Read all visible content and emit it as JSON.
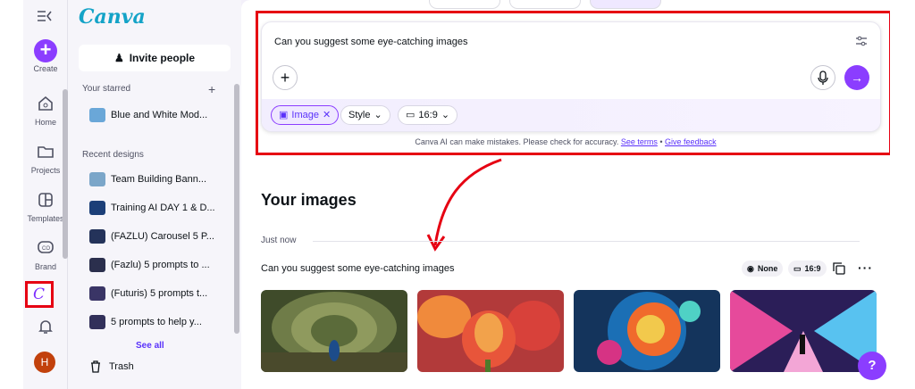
{
  "rail": {
    "create_label": "Create",
    "items": [
      {
        "label": "Home",
        "icon": "home-icon"
      },
      {
        "label": "Projects",
        "icon": "folder-icon"
      },
      {
        "label": "Templates",
        "icon": "templates-icon"
      },
      {
        "label": "Brand",
        "icon": "brand-icon"
      }
    ],
    "avatar_initial": "H"
  },
  "panel": {
    "logo": "Canva",
    "invite_label": "Invite people",
    "starred_title": "Your starred",
    "starred": [
      {
        "name": "Blue and White Mod...",
        "thumb": "#6aa7d8"
      }
    ],
    "recent_title": "Recent designs",
    "recent": [
      {
        "name": "Team Building Bann...",
        "thumb": "#7ba6c9"
      },
      {
        "name": "Training AI DAY 1 & D...",
        "thumb": "#1c3f78"
      },
      {
        "name": "(FAZLU) Carousel 5 P...",
        "thumb": "#24335a"
      },
      {
        "name": "(Fazlu) 5 prompts to ...",
        "thumb": "#2b2f4d"
      },
      {
        "name": "(Futuris) 5 prompts t...",
        "thumb": "#3a3566"
      },
      {
        "name": "5 prompts to help y...",
        "thumb": "#32305a"
      }
    ],
    "see_all": "See all",
    "trash": "Trash"
  },
  "prompt": {
    "text": "Can you suggest some eye-catching images",
    "chips": {
      "image": "Image",
      "style": "Style",
      "ratio": "16:9"
    },
    "disclaimer": "Canva AI can make mistakes. Please check for accuracy.",
    "see_terms": "See terms",
    "separator": "•",
    "give_feedback": "Give feedback"
  },
  "results": {
    "heading": "Your images",
    "time_label": "Just now",
    "prompt_text": "Can you suggest some eye-catching images",
    "style_chip": "None",
    "ratio_chip": "16:9",
    "images": [
      {
        "alt": "peacock",
        "colors": [
          "#5d6a3a",
          "#2f3b22",
          "#7c8a57"
        ]
      },
      {
        "alt": "tulips",
        "colors": [
          "#e8553a",
          "#f2a24b",
          "#c0263d"
        ]
      },
      {
        "alt": "color explosion",
        "colors": [
          "#1b6fb5",
          "#f06a2c",
          "#f2c94c"
        ]
      },
      {
        "alt": "neon street",
        "colors": [
          "#3a2a6e",
          "#e64a9b",
          "#58c2f0"
        ]
      }
    ]
  },
  "help_label": "?",
  "colors": {
    "accent": "#8b3dff",
    "highlight": "#e60012"
  }
}
